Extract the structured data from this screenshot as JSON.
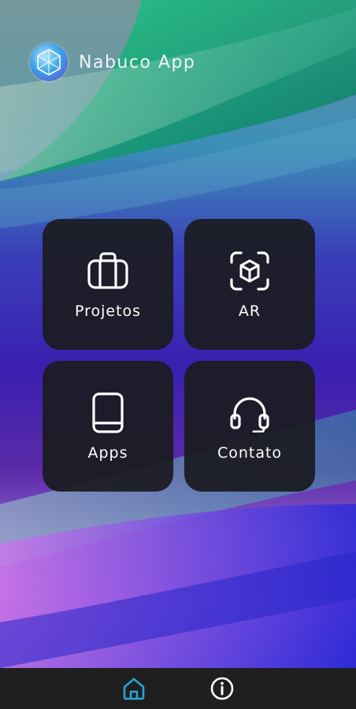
{
  "app": {
    "title": "Nabuco App"
  },
  "tiles": [
    {
      "label": "Projetos",
      "icon": "briefcase-icon"
    },
    {
      "label": "AR",
      "icon": "ar-cube-scan-icon"
    },
    {
      "label": "Apps",
      "icon": "tablet-icon"
    },
    {
      "label": "Contato",
      "icon": "headset-icon"
    }
  ],
  "bottom_nav": [
    {
      "icon": "home-icon",
      "active": true
    },
    {
      "icon": "info-icon",
      "active": false
    }
  ],
  "colors": {
    "tile_bg": "#1c1c22",
    "nav_bg": "#1f1f20",
    "active_icon": "#2aa4d6",
    "inactive_icon": "#ffffff"
  }
}
